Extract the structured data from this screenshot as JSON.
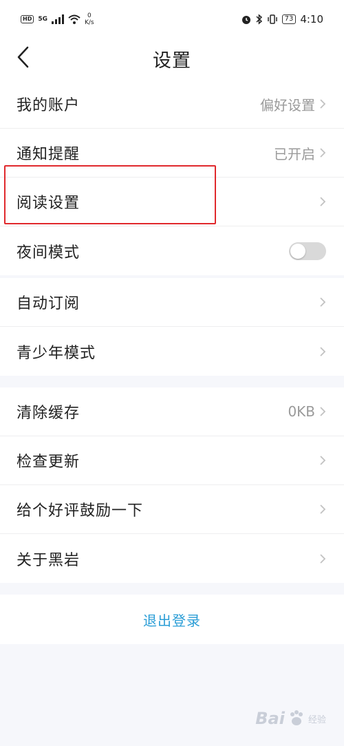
{
  "status_bar": {
    "hd": "HD",
    "network": "5G",
    "speed_value": "0",
    "speed_unit": "K/s",
    "battery": "73",
    "time": "4:10"
  },
  "header": {
    "title": "设置",
    "back_icon": "chevron-left-icon"
  },
  "groups": [
    {
      "items": [
        {
          "label": "我的账户",
          "value": "偏好设置",
          "chevron": true
        },
        {
          "label": "通知提醒",
          "value": "已开启",
          "chevron": true
        },
        {
          "label": "阅读设置",
          "value": "",
          "chevron": true,
          "highlighted": true
        },
        {
          "label": "夜间模式",
          "toggle": false
        }
      ]
    },
    {
      "items": [
        {
          "label": "自动订阅",
          "chevron": true
        },
        {
          "label": "青少年模式",
          "chevron": true
        }
      ]
    },
    {
      "items": [
        {
          "label": "清除缓存",
          "value": "0KB",
          "chevron": true
        },
        {
          "label": "检查更新",
          "chevron": true
        },
        {
          "label": "给个好评鼓励一下",
          "chevron": true
        },
        {
          "label": "关于黑岩",
          "chevron": true
        }
      ]
    }
  ],
  "logout_label": "退出登录",
  "watermark": {
    "text": "Bai",
    "suffix": "经验"
  },
  "colors": {
    "accent": "#2a9dd6",
    "highlight": "#e0282c",
    "toggle_off": "#d9d9d9",
    "page_bg": "#f6f7fb"
  }
}
